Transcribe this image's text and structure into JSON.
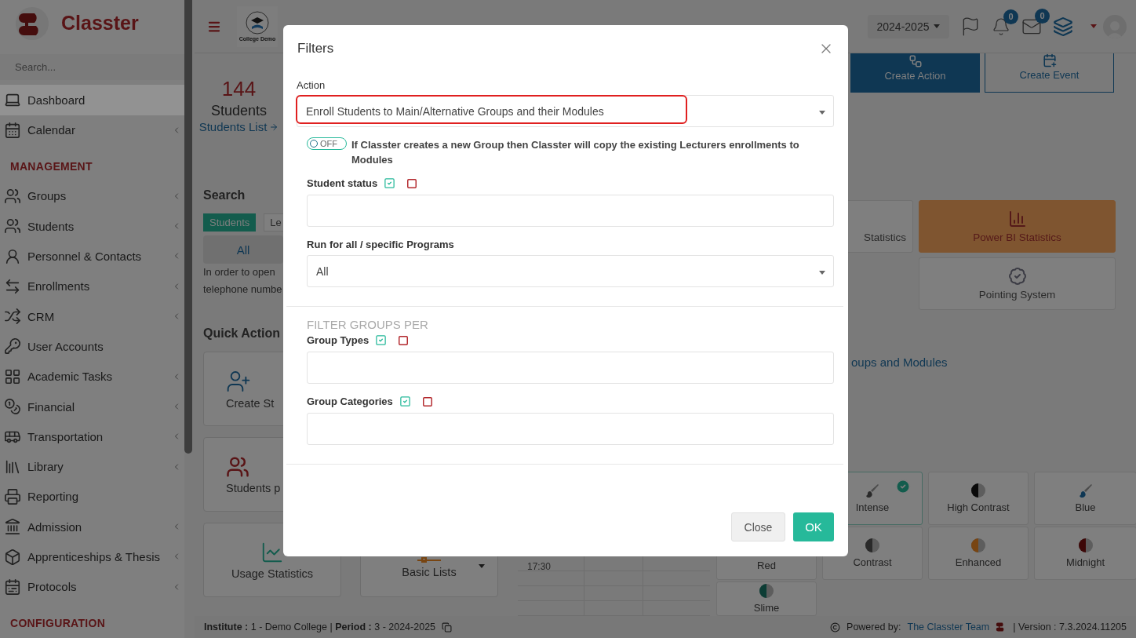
{
  "sidebar": {
    "brand": "Classter",
    "search": {
      "placeholder": "Search..."
    },
    "items": [
      {
        "kind": "link",
        "label": "Dashboard",
        "selected": true,
        "has_submenu": false
      },
      {
        "kind": "link",
        "label": "Calendar",
        "selected": false,
        "has_submenu": true
      },
      {
        "kind": "header",
        "label": "MANAGEMENT"
      },
      {
        "kind": "link",
        "label": "Groups",
        "selected": false,
        "has_submenu": true
      },
      {
        "kind": "link",
        "label": "Students",
        "selected": false,
        "has_submenu": true
      },
      {
        "kind": "link",
        "label": "Personnel & Contacts",
        "selected": false,
        "has_submenu": true
      },
      {
        "kind": "link",
        "label": "Enrollments",
        "selected": false,
        "has_submenu": true
      },
      {
        "kind": "link",
        "label": "CRM",
        "selected": false,
        "has_submenu": true
      },
      {
        "kind": "link",
        "label": "User Accounts",
        "selected": false,
        "has_submenu": false
      },
      {
        "kind": "link",
        "label": "Academic Tasks",
        "selected": false,
        "has_submenu": true
      },
      {
        "kind": "link",
        "label": "Financial",
        "selected": false,
        "has_submenu": true
      },
      {
        "kind": "link",
        "label": "Transportation",
        "selected": false,
        "has_submenu": true
      },
      {
        "kind": "link",
        "label": "Library",
        "selected": false,
        "has_submenu": true
      },
      {
        "kind": "link",
        "label": "Reporting",
        "selected": false,
        "has_submenu": false
      },
      {
        "kind": "link",
        "label": "Admission",
        "selected": false,
        "has_submenu": true
      },
      {
        "kind": "link",
        "label": "Apprenticeships & Thesis",
        "selected": false,
        "has_submenu": true
      },
      {
        "kind": "link",
        "label": "Protocols",
        "selected": false,
        "has_submenu": true
      },
      {
        "kind": "header",
        "label": "CONFIGURATION"
      }
    ]
  },
  "topbar": {
    "logo_caption": "College Demo",
    "year": "2024-2025",
    "notifications": "0",
    "messages": "0"
  },
  "stats": {
    "count": "144",
    "label": "Students",
    "link": "Students List"
  },
  "search": {
    "title": "Search",
    "tabs": [
      {
        "label": "Students",
        "selected": true
      },
      {
        "label": "Le",
        "selected": false
      }
    ],
    "all_button": "All",
    "hint_lines": [
      "In order to open",
      "telephone numbe"
    ]
  },
  "quick_actions": {
    "title": "Quick Action",
    "cards": [
      {
        "kind": "create",
        "label": "Create St",
        "cut": true
      },
      {
        "kind": "hidden"
      },
      {
        "kind": "students",
        "label": "Students p",
        "cut": true
      },
      {
        "kind": "hidden"
      },
      {
        "kind": "usage",
        "label": "Usage Statistics",
        "cut": false
      },
      {
        "kind": "lists",
        "label": "Basic Lists",
        "cut": false
      }
    ]
  },
  "calendar": {
    "time": "17:30"
  },
  "actions": [
    {
      "kind": "filled",
      "label": "Create Action"
    },
    {
      "kind": "outline",
      "label": "Create Event"
    }
  ],
  "stat_cards": [
    {
      "kind": "plain",
      "label": "Statistics"
    },
    {
      "kind": "highlight",
      "label": "Power BI Statistics"
    },
    {
      "kind": "badge",
      "label": "Pointing System"
    }
  ],
  "groups_link": "oups and Modules",
  "themes": [
    {
      "kind": "brush",
      "label": "Intense",
      "color": "#2a2a2a",
      "selected": true
    },
    {
      "kind": "half",
      "label": "High Contrast",
      "color": "#0a0a0a",
      "selected": false
    },
    {
      "kind": "brush",
      "label": "Blue",
      "color": "#0f3754",
      "selected": false
    },
    {
      "kind": "none",
      "label": "Red",
      "selected": false
    },
    {
      "kind": "half",
      "label": "Contrast",
      "color": "#2a2a2a",
      "selected": false
    },
    {
      "kind": "half",
      "label": "Enhanced",
      "color": "#784512",
      "selected": false
    },
    {
      "kind": "half",
      "label": "Midnight",
      "color": "#3d0808",
      "selected": false
    },
    {
      "kind": "half",
      "label": "Slime",
      "color": "#0d3d35",
      "selected": false
    }
  ],
  "footer": {
    "institute": "**Institute :** 1 - Demo College | **Period :** 3 - 2024-2025",
    "powered": "Powered by:",
    "team_link": "The Classter Team",
    "version": "| Version : 7.3.2024.11205"
  },
  "modal": {
    "title": "Filters",
    "action": {
      "label": "Action",
      "value": "Enroll Students to Main/Alternative Groups and their Modules"
    },
    "copy_lecturers": {
      "on": false,
      "toggle_text": "OFF",
      "text": "If Classter creates a new Group then Classter will copy the existing Lecturers enrollments to Modules"
    },
    "student_status": {
      "label": "Student status"
    },
    "programs": {
      "label": "Run for all / specific Programs",
      "value": "All"
    },
    "filter_groups": {
      "title": "FILTER GROUPS PER",
      "fields": [
        {
          "label": "Group Types"
        },
        {
          "label": "Group Categories"
        }
      ]
    },
    "buttons": {
      "close": "Close",
      "ok": "OK"
    }
  }
}
